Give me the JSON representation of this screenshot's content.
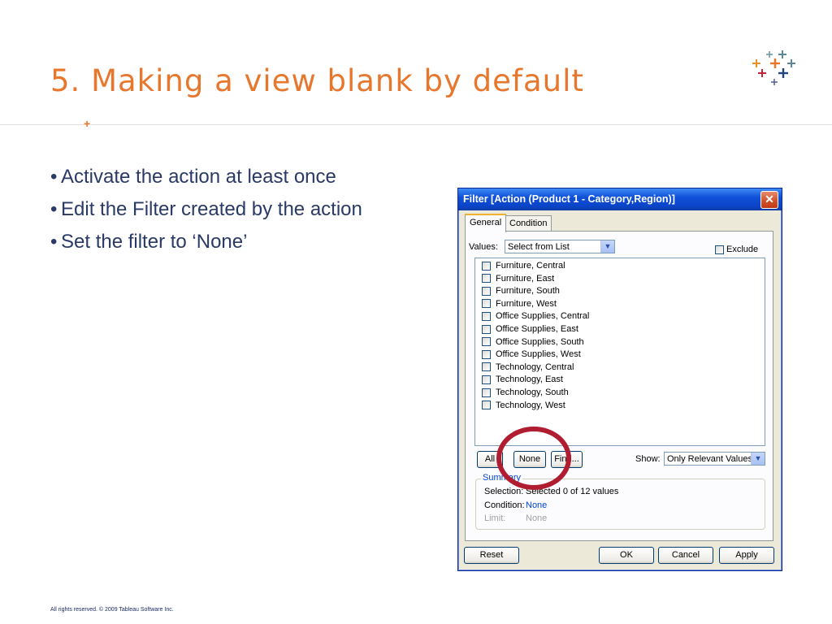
{
  "slide": {
    "title": "5. Making a view blank by default",
    "footer": "All rights reserved. © 2009 Tableau Software Inc.",
    "bullets": [
      "Activate the action at least once",
      "Edit the Filter created by the action",
      "Set the filter to ‘None’"
    ],
    "bullet_marker": "•"
  },
  "dialog": {
    "title": "Filter [Action (Product 1 - Category,Region)]",
    "close_glyph": "✕",
    "tabs": [
      {
        "label": "General",
        "active": true
      },
      {
        "label": "Condition",
        "active": false
      }
    ],
    "values_label": "Values:",
    "values_select": "Select from List",
    "exclude_label": "Exclude",
    "items": [
      "Furniture, Central",
      "Furniture, East",
      "Furniture, South",
      "Furniture, West",
      "Office Supplies, Central",
      "Office Supplies, East",
      "Office Supplies, South",
      "Office Supplies, West",
      "Technology, Central",
      "Technology, East",
      "Technology, South",
      "Technology, West"
    ],
    "all_button": "All",
    "none_button": "None",
    "find_button": "Find...",
    "show_label": "Show:",
    "show_select": "Only Relevant Values",
    "summary": {
      "title": "Summary",
      "selection_label": "Selection:",
      "selection_value": "Selected 0 of 12 values",
      "condition_label": "Condition:",
      "condition_value": "None",
      "limit_label": "Limit:",
      "limit_value": "None"
    },
    "reset_button": "Reset",
    "ok_button": "OK",
    "cancel_button": "Cancel",
    "apply_button": "Apply"
  },
  "colors": {
    "title_orange": "#e8772e",
    "bullet_text": "#2a3a66",
    "highlight_circle": "#b01c30",
    "titlebar_blue": "#0a44c8"
  },
  "icons": {
    "logo": "tableau-plus-logo",
    "dropdown": "chevron-down-icon"
  }
}
